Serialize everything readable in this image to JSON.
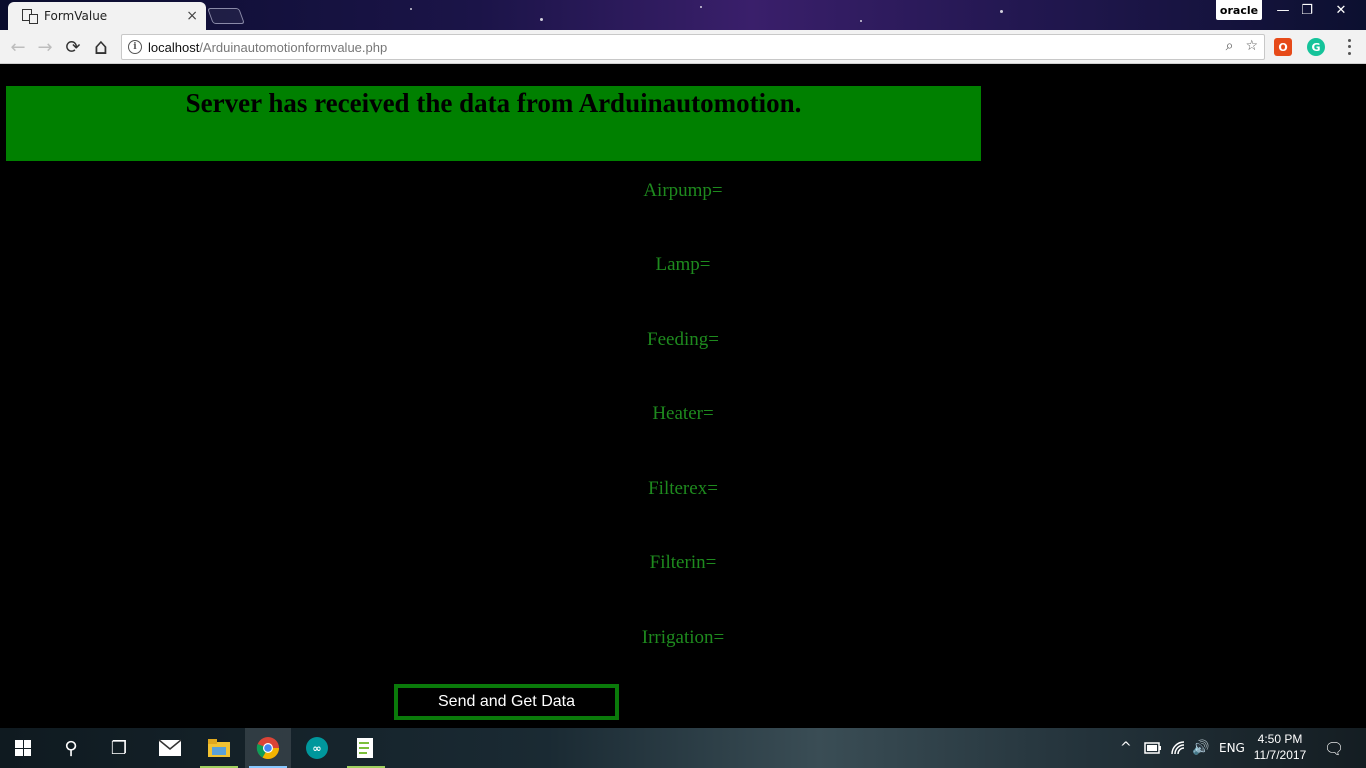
{
  "browser": {
    "tab_title": "FormValue",
    "tab_close": "×",
    "profile_name": "oracle",
    "window_controls": {
      "minimize": "—",
      "restore": "❐",
      "close": "✕"
    },
    "toolbar": {
      "back_icon": "←",
      "forward_icon": "→",
      "reload_icon": "⟳",
      "home_icon": "⌂",
      "info_icon": "i",
      "url_host": "localhost",
      "url_path": "/Arduinautomotionformvalue.php",
      "zoom_icon": "⌕",
      "star_icon": "☆",
      "office_ext": "O",
      "grammarly_ext": "G"
    }
  },
  "page": {
    "banner_title": "Server has received the data from Arduinautomotion.",
    "fields": [
      {
        "label": "Airpump="
      },
      {
        "label": "Lamp="
      },
      {
        "label": "Feeding="
      },
      {
        "label": "Heater="
      },
      {
        "label": "Filterex="
      },
      {
        "label": "Filterin="
      },
      {
        "label": "Irrigation="
      }
    ],
    "submit_label": "Send and Get Data"
  },
  "colors": {
    "banner_bg": "#008000",
    "field_text": "#1e8a1e",
    "button_border": "#0a7a0a"
  },
  "taskbar": {
    "search_icon": "⚲",
    "task_view_icon": "❐",
    "language": "ENG",
    "time": "4:50 PM",
    "date": "11/7/2017",
    "notification_icon": "🗨",
    "tray_up_icon": "^",
    "volume_icon": "🔊"
  }
}
